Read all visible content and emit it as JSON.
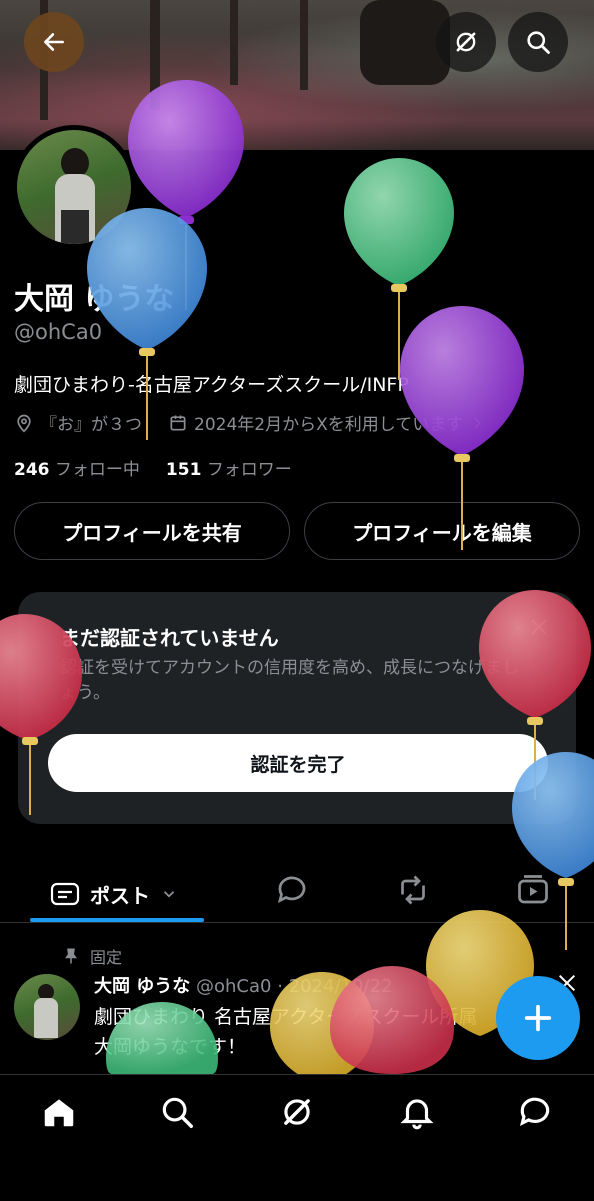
{
  "header": {
    "back_icon": "arrow-left-icon",
    "grok_icon": "grok-icon",
    "search_icon": "search-icon"
  },
  "profile": {
    "name": "大岡 ゆうな",
    "handle": "@ohCa0",
    "bio": "劇団ひまわり-名古屋アクターズスクール/INFP",
    "location": "『お』が３つ",
    "joined": "2024年2月からXを利用しています",
    "following_count": "246",
    "following_label": "フォロー中",
    "followers_count": "151",
    "followers_label": "フォロワー",
    "share_button": "プロフィールを共有",
    "edit_button": "プロフィールを編集"
  },
  "verify": {
    "title": "まだ認証されていません",
    "body": "認証を受けてアカウントの信用度を高め、成長につなげましょう。",
    "button": "認証を完了",
    "close_icon": "close-icon"
  },
  "tabs": {
    "posts_label": "ポスト",
    "icons": [
      "chevron-down-icon",
      "reply-icon",
      "repost-icon",
      "media-icon"
    ]
  },
  "post": {
    "pinned_label": "固定",
    "author": "大岡 ゆうな",
    "meta": "@ohCa0 · 2024/10/22",
    "text_line1": "劇団ひまわり 名古屋アクターズスクール所属",
    "text_line2": "大岡ゆうなです！"
  },
  "nav": {
    "icons": [
      "home-icon",
      "search-icon",
      "grok-icon",
      "notifications-icon",
      "messages-icon"
    ]
  },
  "fab_icon": "plus-icon",
  "colors": {
    "accent": "#1d9bf0",
    "background": "#000000",
    "muted_text": "#8b8f94",
    "card": "#1f2225"
  }
}
